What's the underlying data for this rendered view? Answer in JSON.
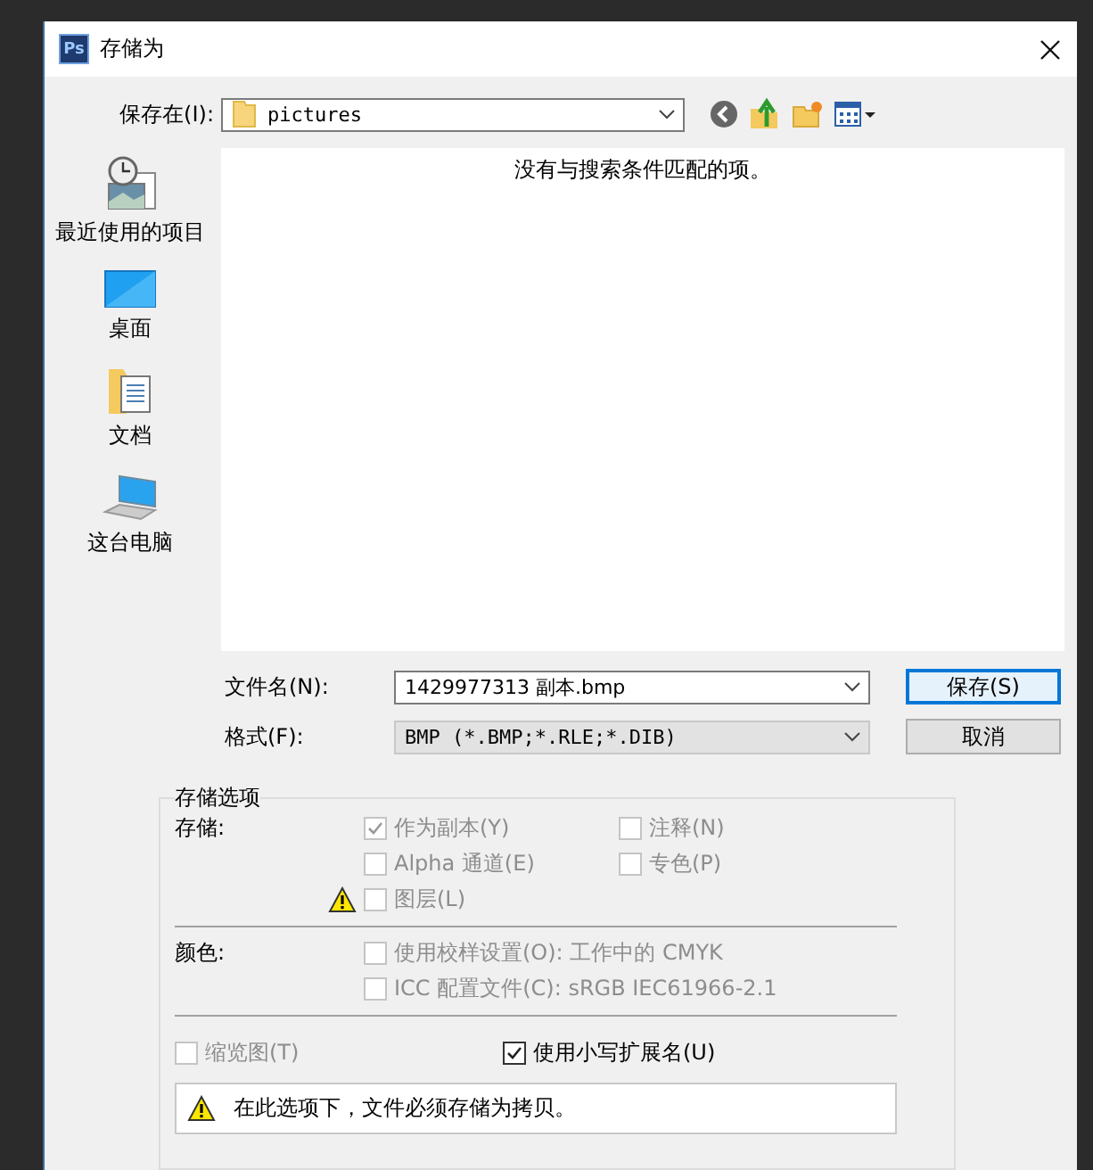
{
  "window": {
    "app_badge": "Ps",
    "title": "存储为"
  },
  "location": {
    "label": "保存在(I):",
    "value": "pictures"
  },
  "places": [
    {
      "kind": "recent",
      "label": "最近使用的项目"
    },
    {
      "kind": "desktop",
      "label": "桌面"
    },
    {
      "kind": "documents",
      "label": "文档"
    },
    {
      "kind": "computer",
      "label": "这台电脑"
    }
  ],
  "file_list": {
    "empty_message": "没有与搜索条件匹配的项。"
  },
  "file_name": {
    "label": "文件名(N):",
    "value": "1429977313 副本.bmp"
  },
  "format": {
    "label": "格式(F):",
    "value": "BMP (*.BMP;*.RLE;*.DIB)"
  },
  "buttons": [
    {
      "label": "保存(S)",
      "default": true
    },
    {
      "label": "取消",
      "default": false
    }
  ],
  "options": {
    "title": "存储选项",
    "save_label": "存储:",
    "save_checks": [
      {
        "label": "作为副本(Y)",
        "checked": true,
        "disabled": true,
        "warning": false
      },
      {
        "label": "注释(N)",
        "checked": false,
        "disabled": true,
        "warning": false
      },
      {
        "label": "Alpha 通道(E)",
        "checked": false,
        "disabled": true,
        "warning": false
      },
      {
        "label": "专色(P)",
        "checked": false,
        "disabled": true,
        "warning": false
      },
      {
        "label": "图层(L)",
        "checked": false,
        "disabled": true,
        "warning": true
      }
    ],
    "color_label": "颜色:",
    "color_checks": [
      {
        "label": "使用校样设置(O):  工作中的 CMYK",
        "checked": false,
        "disabled": true
      },
      {
        "label": "ICC 配置文件(C):  sRGB IEC61966-2.1",
        "checked": false,
        "disabled": true
      }
    ],
    "thumbnail": {
      "label": "缩览图(T)",
      "checked": false,
      "disabled": true
    },
    "lowercase": {
      "label": "使用小写扩展名(U)",
      "checked": true,
      "disabled": false
    },
    "notice": "在此选项下，文件必须存储为拷贝。"
  }
}
